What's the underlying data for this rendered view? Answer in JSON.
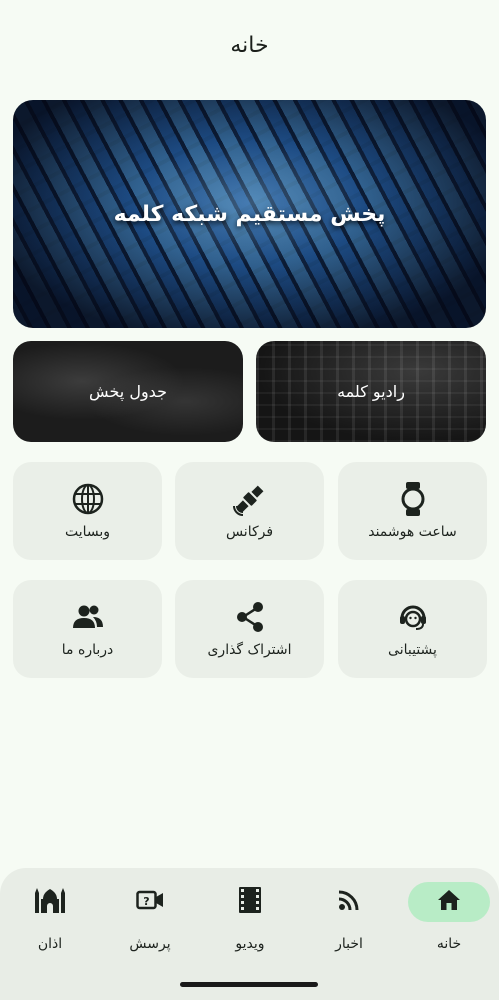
{
  "header": {
    "title": "خانه"
  },
  "hero": {
    "label": "پخش مستقیم شبکه کلمه"
  },
  "media_cards": {
    "radio": "رادیو کلمه",
    "schedule": "جدول پخش"
  },
  "tiles": {
    "smartwatch": {
      "label": "ساعت هوشمند",
      "icon": "watch-icon"
    },
    "frequency": {
      "label": "فرکانس",
      "icon": "satellite-icon"
    },
    "website": {
      "label": "وبسایت",
      "icon": "globe-icon"
    },
    "support": {
      "label": "پشتیبانی",
      "icon": "support-agent-icon"
    },
    "share": {
      "label": "اشتراک گذاری",
      "icon": "share-icon"
    },
    "about": {
      "label": "درباره ما",
      "icon": "people-icon"
    }
  },
  "bottom_nav": {
    "items": [
      {
        "label": "خانه",
        "icon": "home-icon",
        "active": true
      },
      {
        "label": "اخبار",
        "icon": "rss-icon",
        "active": false
      },
      {
        "label": "ویدیو",
        "icon": "film-icon",
        "active": false
      },
      {
        "label": "پرسش",
        "icon": "video-question-icon",
        "active": false
      },
      {
        "label": "اذان",
        "icon": "mosque-icon",
        "active": false
      }
    ]
  },
  "colors": {
    "background": "#f6fbf4",
    "tile": "#eaefe8",
    "nav_active": "#b8ecc6",
    "text": "#1d231e"
  }
}
